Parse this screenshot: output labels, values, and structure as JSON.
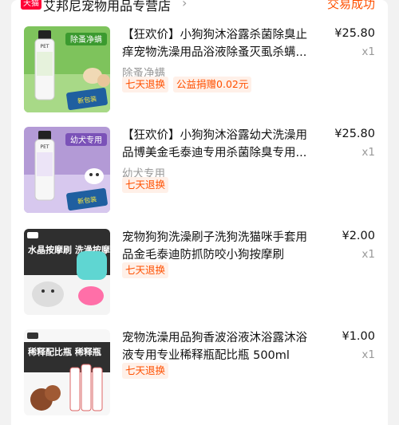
{
  "store": {
    "badge": "天猫",
    "name": "艾邦尼宠物用品专营店",
    "chevron": "›",
    "status": "交易成功"
  },
  "products": [
    {
      "title": "【狂欢价】小狗狗沐浴露杀菌除臭止痒宠物洗澡用品浴液除蚤灭虱杀螨...",
      "sku": "除蚤净螨",
      "price": "¥25.80",
      "qty": "x1",
      "tags": [
        "七天退换",
        "公益捐赠0.02元"
      ],
      "image_text": "除蚤净螨",
      "image_badge": "新包装 升级版"
    },
    {
      "title": "【狂欢价】小狗狗沐浴露幼犬洗澡用品博美金毛泰迪专用杀菌除臭专用...",
      "sku": "幼犬专用",
      "price": "¥25.80",
      "qty": "x1",
      "tags": [
        "七天退换"
      ],
      "image_text": "幼犬专用",
      "image_badge": "新包装 升级版"
    },
    {
      "title": "宠物狗狗洗澡刷子洗狗洗猫咪手套用品金毛泰迪防抓防咬小狗按摩刷",
      "sku": "",
      "price": "¥2.00",
      "qty": "x1",
      "tags": [
        "七天退换"
      ],
      "image_text": "水晶按摩刷 洗澡按摩"
    },
    {
      "title": "宠物洗澡用品狗香波浴液沐浴露沐浴液专用专业稀释瓶配比瓶 500ml",
      "sku": "",
      "price": "¥1.00",
      "qty": "x1",
      "tags": [
        "七天退换"
      ],
      "image_text": "稀释配比瓶 稀释瓶"
    }
  ]
}
